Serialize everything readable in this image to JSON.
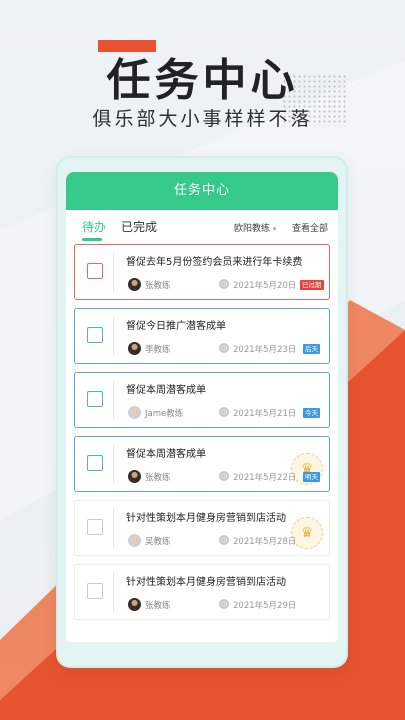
{
  "hero": {
    "title": "任务中心",
    "subtitle": "俱乐部大小事样样不落"
  },
  "app": {
    "title": "任务中心",
    "tabs": [
      "待办",
      "已完成"
    ],
    "filter_label": "欧阳教练",
    "view_all": "查看全部"
  },
  "tasks": [
    {
      "title": "督促去年5月份签约会员来进行年卡续费",
      "coach": "张教练",
      "date": "2021年5月20日",
      "badge": "已过期",
      "status": "overdue"
    },
    {
      "title": "督促今日推广潜客成单",
      "coach": "李教练",
      "date": "2021年5月23日",
      "badge": "后天",
      "status": "upcoming"
    },
    {
      "title": "督促本周潜客成单",
      "coach": "Jame教练",
      "date": "2021年5月21日",
      "badge": "今天",
      "status": "upcoming"
    },
    {
      "title": "督促本周潜客成单",
      "coach": "张教练",
      "date": "2021年5月22日",
      "badge": "明天",
      "status": "upcoming"
    },
    {
      "title": "针对性策划本月健身房营销到店活动",
      "coach": "吴教练",
      "date": "2021年5月28日",
      "badge": "",
      "status": "normal"
    },
    {
      "title": "针对性策划本月健身房营销到店活动",
      "coach": "张教练",
      "date": "2021年5月29日",
      "badge": "",
      "status": "normal"
    }
  ],
  "icons": {
    "clock": "clock-icon",
    "crown": "crown-icon",
    "dropdown": "chevron-down-icon"
  },
  "colors": {
    "accent_green": "#35c98a",
    "overdue_red": "#e4443b",
    "upcoming_blue": "#3a99e0",
    "brand_orange": "#e8532f"
  }
}
